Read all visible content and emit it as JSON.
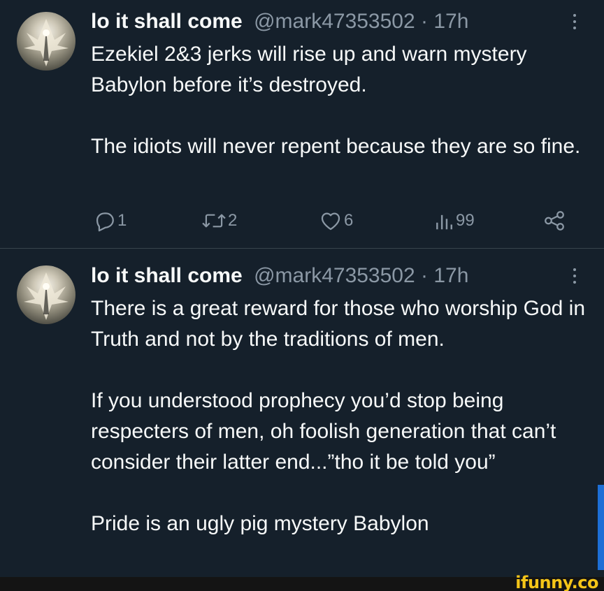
{
  "colors": {
    "background": "#15202b",
    "text": "#f7f9f9",
    "secondary_text": "#8b98a5",
    "divider": "#38444d",
    "watermark": "#f5c518"
  },
  "tweets": [
    {
      "author_name": "lo it shall come",
      "handle": "@mark47353502",
      "separator": "·",
      "time": "17h",
      "avatar": "angel-figure-avatar",
      "paragraphs": [
        "Ezekiel 2&3 jerks will rise up and warn mystery Babylon before it’s destroyed.",
        "The idiots will never repent because they are so fine."
      ],
      "actions": {
        "reply_count": "1",
        "retweet_count": "2",
        "like_count": "6",
        "views_count": "99"
      }
    },
    {
      "author_name": "lo it shall come",
      "handle": "@mark47353502",
      "separator": "·",
      "time": "17h",
      "avatar": "angel-figure-avatar",
      "paragraphs": [
        "There is a great reward for those who worship God in Truth and not by the traditions of men.",
        "If you understood prophecy you’d stop being respecters of men, oh foolish generation that can’t consider their latter end...”tho it be told you”",
        "Pride is an ugly pig mystery Babylon"
      ]
    }
  ],
  "watermark": {
    "text": "ifunny.co"
  }
}
